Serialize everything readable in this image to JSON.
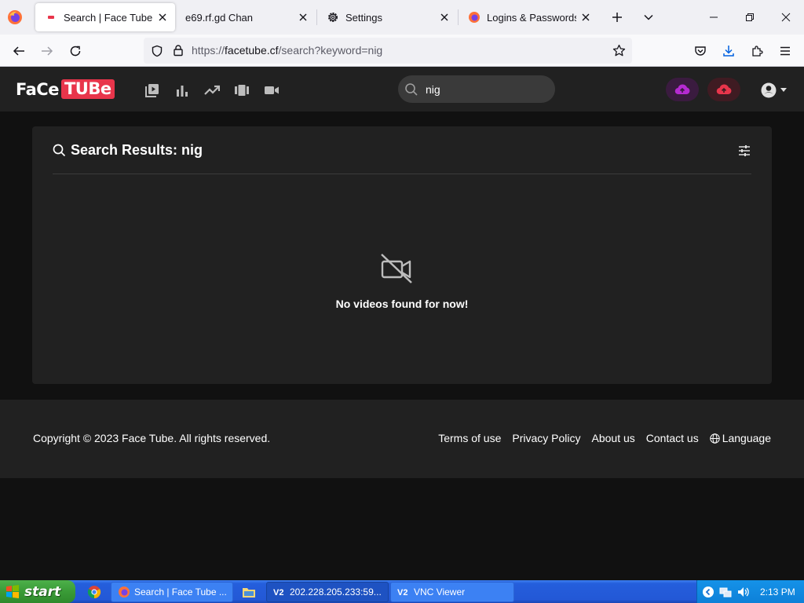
{
  "browser": {
    "tabs": [
      {
        "title": "Search | Face Tube",
        "active": true,
        "icon": "facetube-favicon"
      },
      {
        "title": "e69.rf.gd Chan",
        "active": false,
        "icon": "none"
      },
      {
        "title": "Settings",
        "active": false,
        "icon": "gear-icon"
      },
      {
        "title": "Logins & Passwords",
        "active": false,
        "icon": "firefox-icon"
      }
    ],
    "url": {
      "prefix": "https://",
      "domain": "facetube.cf",
      "path": "/search?keyword=nig"
    }
  },
  "site": {
    "logo": {
      "part1": "FaCe",
      "part2": "TUBe"
    },
    "nav_icons": [
      "video-library-icon",
      "bar-chart-icon",
      "trending-icon",
      "shorts-icon",
      "camera-icon"
    ],
    "search": {
      "value": "nig",
      "placeholder": ""
    },
    "upload_colors": {
      "purple": "#b52bd1",
      "red": "#e8354b"
    }
  },
  "results": {
    "title": "Search Results: nig",
    "empty_message": "No videos found for now!"
  },
  "footer": {
    "copyright": "Copyright © 2023 Face Tube. All rights reserved.",
    "links": [
      "Terms of use",
      "Privacy Policy",
      "About us",
      "Contact us"
    ],
    "language": "Language"
  },
  "taskbar": {
    "start_label": "start",
    "buttons": [
      {
        "label": "Search | Face Tube ...",
        "active": false,
        "icon": "firefox-icon"
      },
      {
        "label": "202.228.205.233:59...",
        "active": true,
        "icon": "vnc-icon"
      },
      {
        "label": "VNC Viewer",
        "active": false,
        "icon": "vnc-icon"
      }
    ],
    "clock": "2:13 PM"
  }
}
